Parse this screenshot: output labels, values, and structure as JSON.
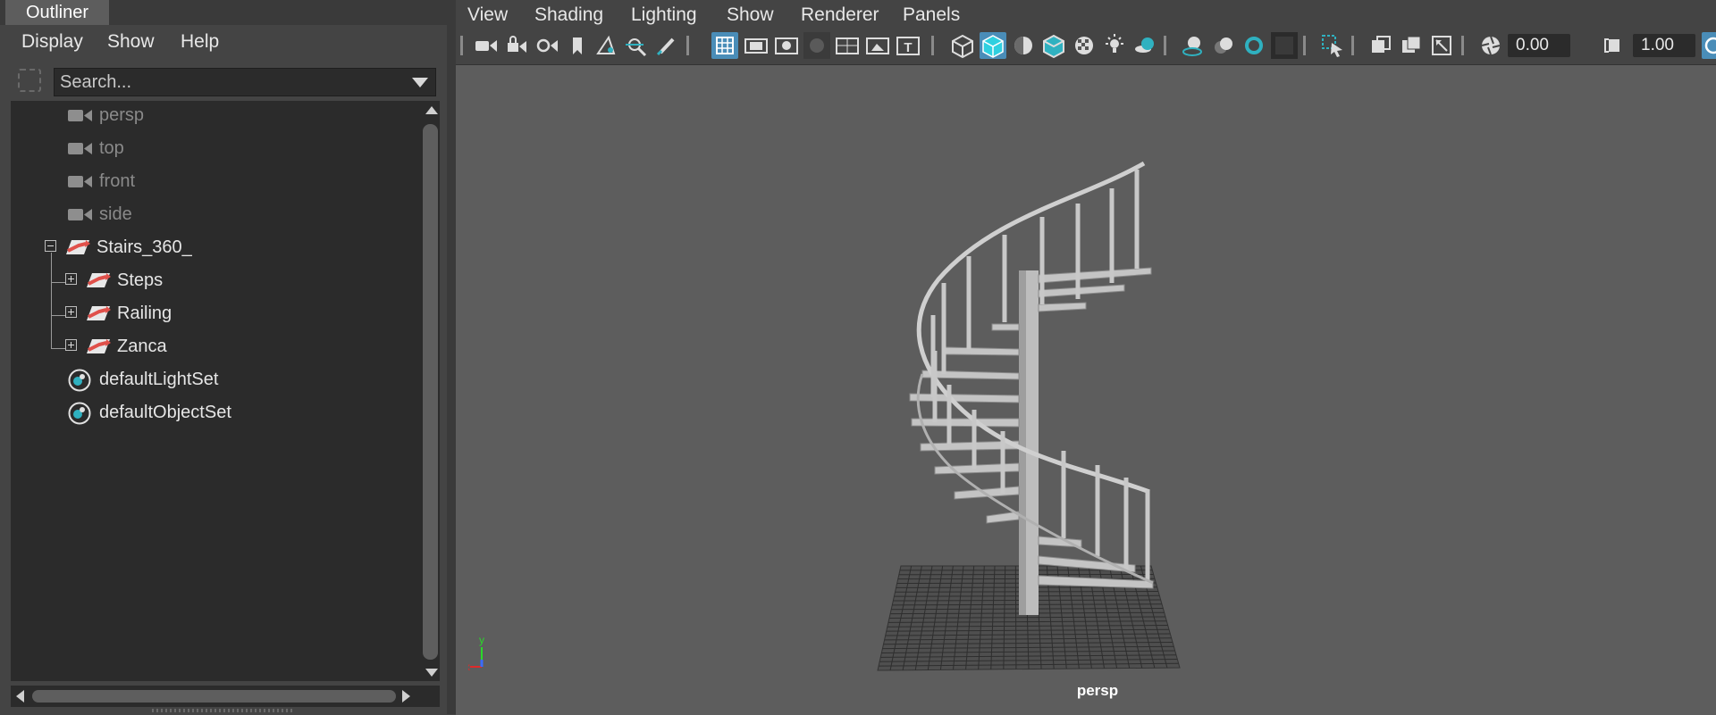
{
  "outliner": {
    "tab": "Outliner",
    "menu": [
      "Display",
      "Show",
      "Help"
    ],
    "search": {
      "placeholder": "Search..."
    },
    "tree": {
      "cameras": [
        "persp",
        "top",
        "front",
        "side"
      ],
      "group": {
        "label": "Stairs_360_",
        "children": [
          "Steps",
          "Railing",
          "Zanca"
        ]
      },
      "sets": [
        "defaultLightSet",
        "defaultObjectSet"
      ]
    }
  },
  "viewport": {
    "menu": [
      "View",
      "Shading",
      "Lighting",
      "Show",
      "Renderer",
      "Panels"
    ],
    "toolbar": {
      "exposure_value": "0.00",
      "gamma_value": "1.00"
    },
    "camera_label": "persp",
    "axis": {
      "x": "x",
      "y": "y"
    }
  },
  "colors": {
    "background": "#444444",
    "panel_dark": "#2b2b2b",
    "viewport_bg": "#5d5d5d",
    "accent_active": "#4a8db8",
    "transform_icon": "#e0504a",
    "set_icon_fill": "#2fb1c0",
    "axis_x": "#e02a2a",
    "axis_y": "#2ad82a",
    "axis_z": "#3a6cff"
  },
  "icons": {
    "camera": "camera-icon",
    "transform": "transform-node-icon",
    "set": "object-set-icon"
  }
}
